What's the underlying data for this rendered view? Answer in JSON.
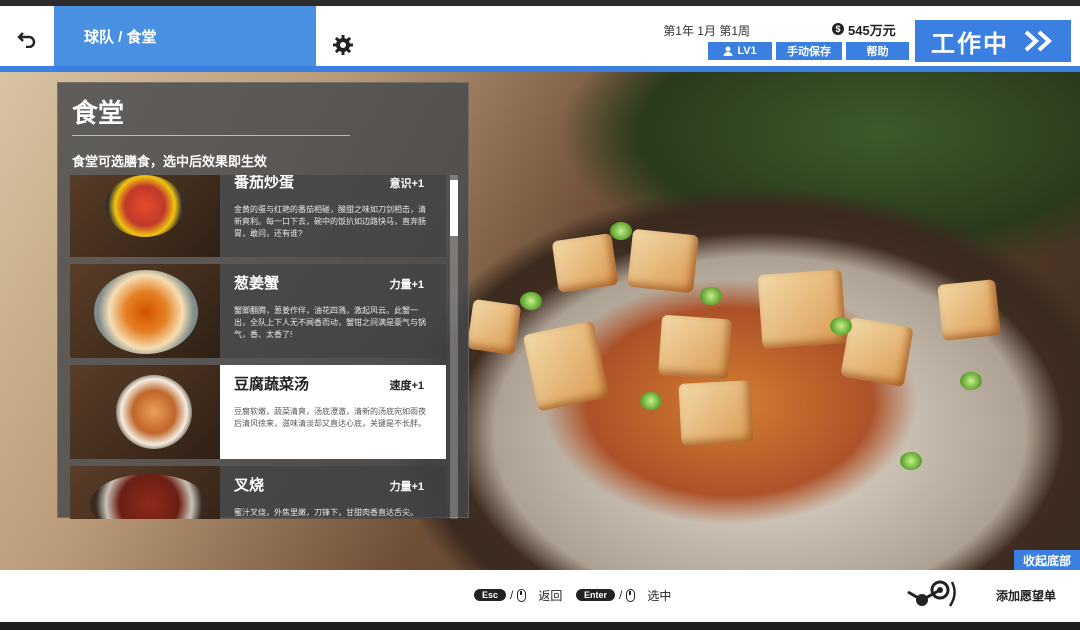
{
  "header": {
    "breadcrumb": "球队 / 食堂",
    "date": "第1年 1月 第1周",
    "money": "545万元",
    "level": "LV1",
    "save_label": "手动保存",
    "help_label": "帮助",
    "work_label": "工作中",
    "accent": "#3b7fe0"
  },
  "panel": {
    "title": "食堂",
    "subtitle": "食堂可选膳食，选中后效果即生效",
    "items": [
      {
        "name": "番茄炒蛋",
        "effect": "意识+1",
        "desc": "金黄的蛋与红艳的番茄相碰，酸甜之味如刀剑相击，清新爽利。每一口下去，碗中的饭扒如边路快马，直奔肠胃，敢问，还有谁?",
        "selected": false
      },
      {
        "name": "葱姜蟹",
        "effect": "力量+1",
        "desc": "蟹脚翻腾，葱姜作伴，油花四溅，激起风云。此蟹一出，全队上下人无不闻香而动，蟹钳之间满是豪气与锅气，香、太香了!",
        "selected": false
      },
      {
        "name": "豆腐蔬菜汤",
        "effect": "速度+1",
        "desc": "豆腐软嫩，蔬菜清爽，汤底澄澈，清新的汤底宛如雨夜后清风徐来，滋味清淡却又直达心底，关键是不长胖。",
        "selected": true
      },
      {
        "name": "叉烧",
        "effect": "力量+1",
        "desc": "蜜汁叉烧，外焦里嫩，刀锋下，甘甜肉香直达舌尖。",
        "selected": false
      }
    ],
    "scroll_fraction": 0.16
  },
  "footer": {
    "collapse_label": "收起底部",
    "esc_key": "Esc",
    "back_label": "返回",
    "enter_key": "Enter",
    "select_label": "选中",
    "wishlist_label": "添加愿望单"
  },
  "icons": {
    "back": "undo-arrow-icon",
    "settings": "gear-icon",
    "money": "coin-icon",
    "user": "user-icon",
    "work": "double-chevron-icon",
    "mouse": "mouse-icon",
    "wishlist": "steam-logo-icon"
  }
}
